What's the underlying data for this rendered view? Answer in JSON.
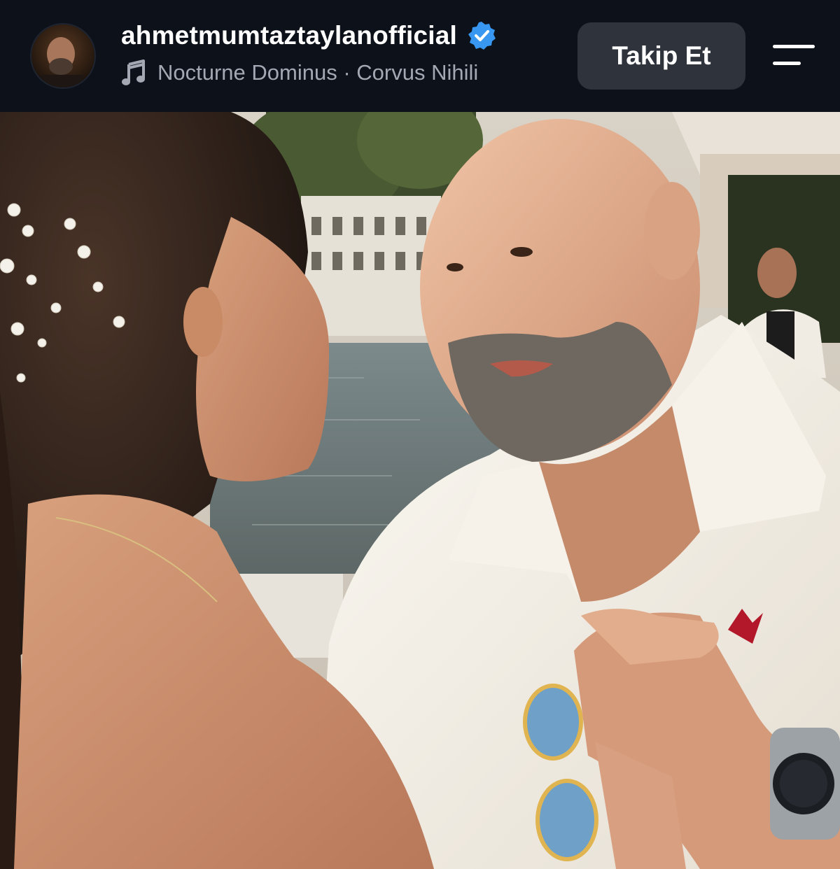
{
  "header": {
    "username": "ahmetmumtaztaylanofficial",
    "music": {
      "track": "Nocturne Dominus",
      "separator": " · ",
      "artist": "Corvus Nihili"
    },
    "follow_label": "Takip Et",
    "icons": {
      "verified": "verified-badge-icon",
      "music": "music-note-icon",
      "menu": "menu-icon"
    },
    "colors": {
      "verified": "#3897f0",
      "background": "#0d111a",
      "button": "#2e333c"
    }
  },
  "post": {
    "image_description_icon": "photo"
  }
}
